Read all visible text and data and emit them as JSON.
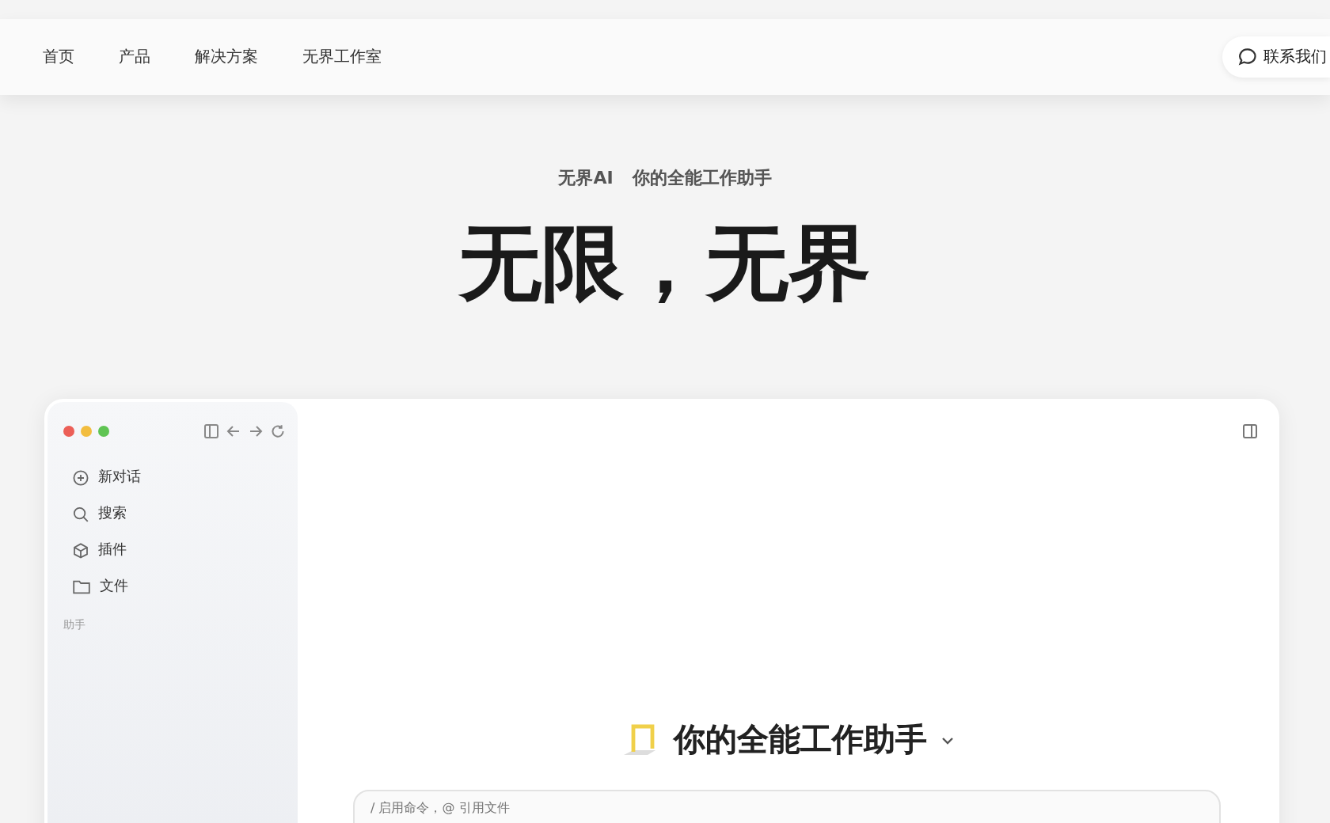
{
  "nav": {
    "links": [
      "首页",
      "产品",
      "解决方案",
      "无界工作室"
    ],
    "contact": "联系我们"
  },
  "hero": {
    "tagline_brand": "无界AI",
    "tagline_text": "你的全能工作助手",
    "headline": "无限，无界"
  },
  "app_window": {
    "sidebar": {
      "items": [
        {
          "kind": "new-chat",
          "label": "新对话"
        },
        {
          "kind": "search",
          "label": "搜索"
        },
        {
          "kind": "plugin",
          "label": "插件"
        },
        {
          "kind": "folder",
          "label": "文件"
        }
      ],
      "section_label": "助手"
    },
    "assistant_title": "你的全能工作助手",
    "input": {
      "placeholder": "/ 启用命令，@ 引用文件"
    }
  }
}
